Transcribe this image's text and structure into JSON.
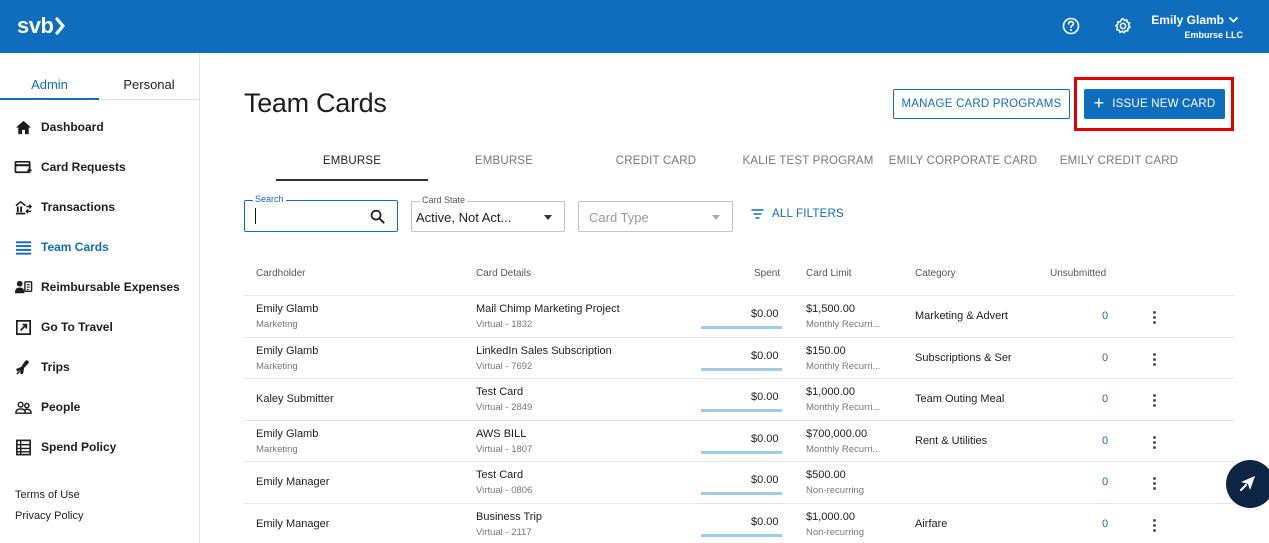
{
  "header": {
    "logo": "svb",
    "user_name": "Emily Glamb",
    "user_org": "Emburse LLC",
    "icons": [
      "help-icon",
      "gear-icon",
      "chevron-down-icon"
    ]
  },
  "sidebar": {
    "tabs": [
      "Admin",
      "Personal"
    ],
    "active_tab": "Admin",
    "items": [
      {
        "label": "Dashboard",
        "icon": "home-icon"
      },
      {
        "label": "Card Requests",
        "icon": "card-request-icon"
      },
      {
        "label": "Transactions",
        "icon": "transactions-icon"
      },
      {
        "label": "Team Cards",
        "icon": "team-cards-icon"
      },
      {
        "label": "Reimbursable Expenses",
        "icon": "reimbursable-icon"
      },
      {
        "label": "Go To Travel",
        "icon": "external-link-icon"
      },
      {
        "label": "Trips",
        "icon": "plane-icon"
      },
      {
        "label": "People",
        "icon": "people-icon"
      },
      {
        "label": "Spend Policy",
        "icon": "policy-icon"
      }
    ],
    "active_item": "Team Cards",
    "footer_links": [
      "Terms of Use",
      "Privacy Policy"
    ]
  },
  "main": {
    "title": "Team Cards",
    "manage_button": "MANAGE CARD PROGRAMS",
    "issue_button": "ISSUE NEW CARD",
    "program_tabs": [
      "EMBURSE",
      "EMBURSE",
      "CREDIT CARD",
      "KALIE TEST PROGRAM",
      "EMILY CORPORATE CARD",
      "EMILY CREDIT CARD"
    ],
    "active_program_tab": 0,
    "filters": {
      "search_label": "Search",
      "search_value": "",
      "card_state_label": "Card State",
      "card_state_value": "Active, Not Act...",
      "card_type_placeholder": "Card Type",
      "all_filters": "ALL FILTERS"
    },
    "table": {
      "columns": [
        "Cardholder",
        "Card Details",
        "Spent",
        "Card Limit",
        "Category",
        "Unsubmitted"
      ],
      "rows": [
        {
          "name": "Emily Glamb",
          "dept": "Marketing",
          "card": "Mail Chimp Marketing Project",
          "card_sub": "Virtual - 1832",
          "spent": "$0.00",
          "limit": "$1,500.00",
          "limit_sub": "Monthly Recurri...",
          "category": "Marketing & Advert",
          "unsubmitted": "0"
        },
        {
          "name": "Emily Glamb",
          "dept": "Marketing",
          "card": "LinkedIn Sales Subscription",
          "card_sub": "Virtual - 7692",
          "spent": "$0.00",
          "limit": "$150.00",
          "limit_sub": "Monthly Recurri...",
          "category": "Subscriptions & Ser",
          "unsubmitted": "0"
        },
        {
          "name": "Kaley Submitter",
          "dept": "",
          "card": "Test Card",
          "card_sub": "Virtual - 2849",
          "spent": "$0.00",
          "limit": "$1,000.00",
          "limit_sub": "Monthly Recurri...",
          "category": "Team Outing Meal",
          "unsubmitted": "0"
        },
        {
          "name": "Emily Glamb",
          "dept": "Marketing",
          "card": "AWS BILL",
          "card_sub": "Virtual - 1807",
          "spent": "$0.00",
          "limit": "$700,000.00",
          "limit_sub": "Monthly Recurri...",
          "category": "Rent & Utilities",
          "unsubmitted": "0"
        },
        {
          "name": "Emily Manager",
          "dept": "",
          "card": "Test Card",
          "card_sub": "Virtual - 0806",
          "spent": "$0.00",
          "limit": "$500.00",
          "limit_sub": "Non-recurring",
          "category": "",
          "unsubmitted": "0"
        },
        {
          "name": "Emily Manager",
          "dept": "",
          "card": "Business Trip",
          "card_sub": "Virtual - 2117",
          "spent": "$0.00",
          "limit": "$1,000.00",
          "limit_sub": "Non-recurring",
          "category": "Airfare",
          "unsubmitted": "0"
        }
      ]
    }
  },
  "colors": {
    "brand": "#0f6dbd",
    "highlight": "#e00000",
    "spend_bar": "#9fcbe6",
    "chat": "#0d2544"
  }
}
